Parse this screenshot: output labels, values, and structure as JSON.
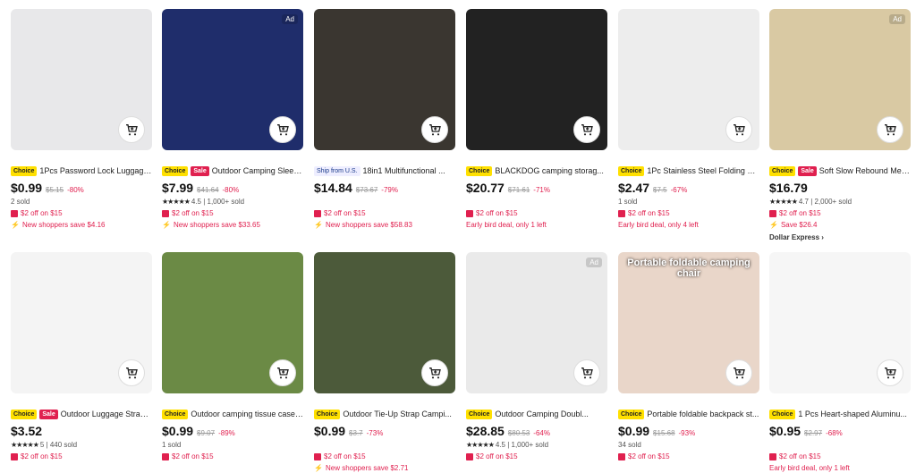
{
  "products": [
    {
      "name": "1Pcs Password Lock Luggage...",
      "price": "$0.99",
      "orig": "$5.15",
      "disc": "-80%",
      "badges": [
        "Choice"
      ],
      "ad": false,
      "meta": "2 sold",
      "promo1": "$2 off on $15",
      "promo2": "New shoppers save $4.16",
      "bg": "#e8e8ea"
    },
    {
      "name": "Outdoor Camping Sleepi...",
      "price": "$7.99",
      "orig": "$41.64",
      "disc": "-80%",
      "badges": [
        "Choice",
        "Sale"
      ],
      "ad": true,
      "meta": "4.5 | 1,000+ sold",
      "rating": true,
      "promo1": "$2 off on $15",
      "promo2": "New shoppers save $33.65",
      "bg": "#1f2d6b"
    },
    {
      "name": "18in1 Multifunctional ...",
      "price": "$14.84",
      "orig": "$73.67",
      "disc": "-79%",
      "badges": [
        "Ship from U.S."
      ],
      "ad": false,
      "meta": "",
      "promo1": "$2 off on $15",
      "promo2": "New shoppers save $58.83",
      "bg": "#3a3630"
    },
    {
      "name": "BLACKDOG camping storag...",
      "price": "$20.77",
      "orig": "$71.61",
      "disc": "-71%",
      "badges": [
        "Choice"
      ],
      "ad": false,
      "meta": "",
      "promo1": "$2 off on $15",
      "promo2": "Early bird deal, only 1 left",
      "bg": "#222"
    },
    {
      "name": "1Pc Stainless Steel Folding H...",
      "price": "$2.47",
      "orig": "$7.5",
      "disc": "-67%",
      "badges": [
        "Choice"
      ],
      "ad": false,
      "meta": "1 sold",
      "promo1": "$2 off on $15",
      "promo2": "Early bird deal, only 4 left",
      "bg": "#ededed"
    },
    {
      "name": "Soft Slow Rebound Mem...",
      "price": "$16.79",
      "orig": "",
      "disc": "",
      "badges": [
        "Choice",
        "Sale"
      ],
      "ad": true,
      "meta": "4.7 | 2,000+ sold",
      "rating": true,
      "promo1": "$2 off on $15",
      "promo2": "Save $26.4",
      "extra": "Dollar Express ›",
      "bg": "#d9c9a3"
    },
    {
      "name": "Outdoor Luggage Strap ...",
      "price": "$3.52",
      "orig": "",
      "disc": "",
      "badges": [
        "Choice",
        "Sale"
      ],
      "ad": false,
      "meta": "5 | 440 sold",
      "rating": true,
      "promo1": "$2 off on $15",
      "promo2": "",
      "bg": "#f4f4f4"
    },
    {
      "name": "Outdoor camping tissue case ...",
      "price": "$0.99",
      "orig": "$9.07",
      "disc": "-89%",
      "badges": [
        "Choice"
      ],
      "ad": false,
      "meta": "1 sold",
      "promo1": "$2 off on $15",
      "promo2": "",
      "bg": "#6b8a45"
    },
    {
      "name": "Outdoor Tie-Up Strap Campi...",
      "price": "$0.99",
      "orig": "$3.7",
      "disc": "-73%",
      "badges": [
        "Choice"
      ],
      "ad": false,
      "meta": "",
      "promo1": "$2 off on $15",
      "promo2": "New shoppers save $2.71",
      "bg": "#4c5a3a"
    },
    {
      "name": "Outdoor Camping Doubl...",
      "price": "$28.85",
      "orig": "$80.53",
      "disc": "-64%",
      "badges": [
        "Choice"
      ],
      "ad": true,
      "meta": "4.5 | 1,000+ sold",
      "rating": true,
      "promo1": "$2 off on $15",
      "promo2": "",
      "bg": "#eaeaea"
    },
    {
      "name": "Portable foldable backpack st...",
      "price": "$0.99",
      "orig": "$15.68",
      "disc": "-93%",
      "badges": [
        "Choice"
      ],
      "ad": false,
      "meta": "34 sold",
      "promo1": "$2 off on $15",
      "promo2": "",
      "overlay": "Portable foldable camping chair",
      "bg": "#e9d6c9"
    },
    {
      "name": "1 Pcs Heart-shaped Aluminu...",
      "price": "$0.95",
      "orig": "$2.97",
      "disc": "-68%",
      "badges": [
        "Choice"
      ],
      "ad": false,
      "meta": "",
      "promo1": "$2 off on $15",
      "promo2": "Early bird deal, only 1 left",
      "bg": "#f6f6f6"
    }
  ],
  "ad_label": "Ad",
  "colors": {
    "accent": "#e0204f",
    "choice": "#ffe000"
  }
}
